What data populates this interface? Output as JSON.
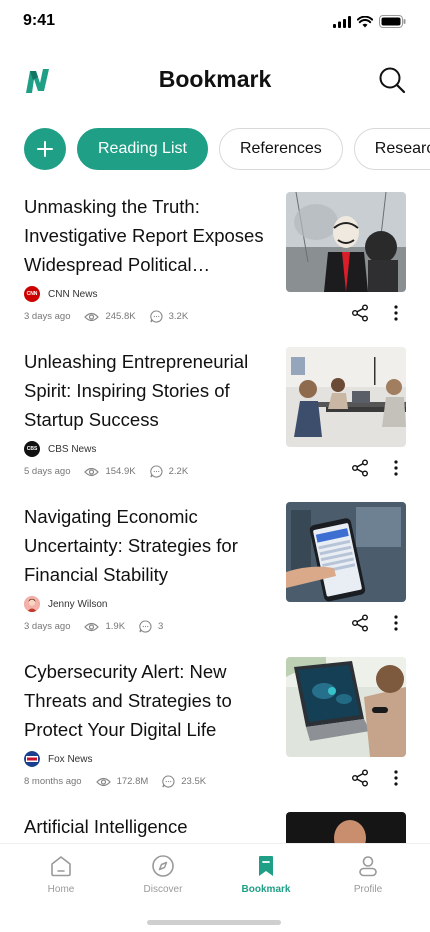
{
  "status_bar": {
    "time": "9:41"
  },
  "header": {
    "title": "Bookmark"
  },
  "tabs": [
    {
      "label": "Reading List",
      "active": true
    },
    {
      "label": "References",
      "active": false
    },
    {
      "label": "Research",
      "active": false
    }
  ],
  "articles": [
    {
      "title": "Unmasking the Truth: Investigative Report Exposes Widespread Political Corruption",
      "source": "CNN News",
      "time": "3 days ago",
      "views": "245.8K",
      "comments": "3.2K"
    },
    {
      "title": "Unleashing Entrepreneurial Spirit: Inspiring Stories of Startup Success",
      "source": "CBS News",
      "time": "5 days ago",
      "views": "154.9K",
      "comments": "2.2K"
    },
    {
      "title": "Navigating Economic Uncertainty: Strategies for Financial Stability",
      "source": "Jenny Wilson",
      "time": "3 days ago",
      "views": "1.9K",
      "comments": "3"
    },
    {
      "title": "Cybersecurity Alert: New Threats and Strategies to Protect Your Digital Life",
      "source": "Fox News",
      "time": "8 months ago",
      "views": "172.8M",
      "comments": "23.5K"
    },
    {
      "title": "Artificial Intelligence"
    }
  ],
  "bottom_nav": [
    {
      "label": "Home",
      "icon": "home-icon"
    },
    {
      "label": "Discover",
      "icon": "compass-icon"
    },
    {
      "label": "Bookmark",
      "icon": "bookmark-icon",
      "active": true
    },
    {
      "label": "Profile",
      "icon": "profile-icon"
    }
  ],
  "colors": {
    "accent": "#1f9f86",
    "cnn": "#cc0000",
    "muted": "#777777"
  }
}
